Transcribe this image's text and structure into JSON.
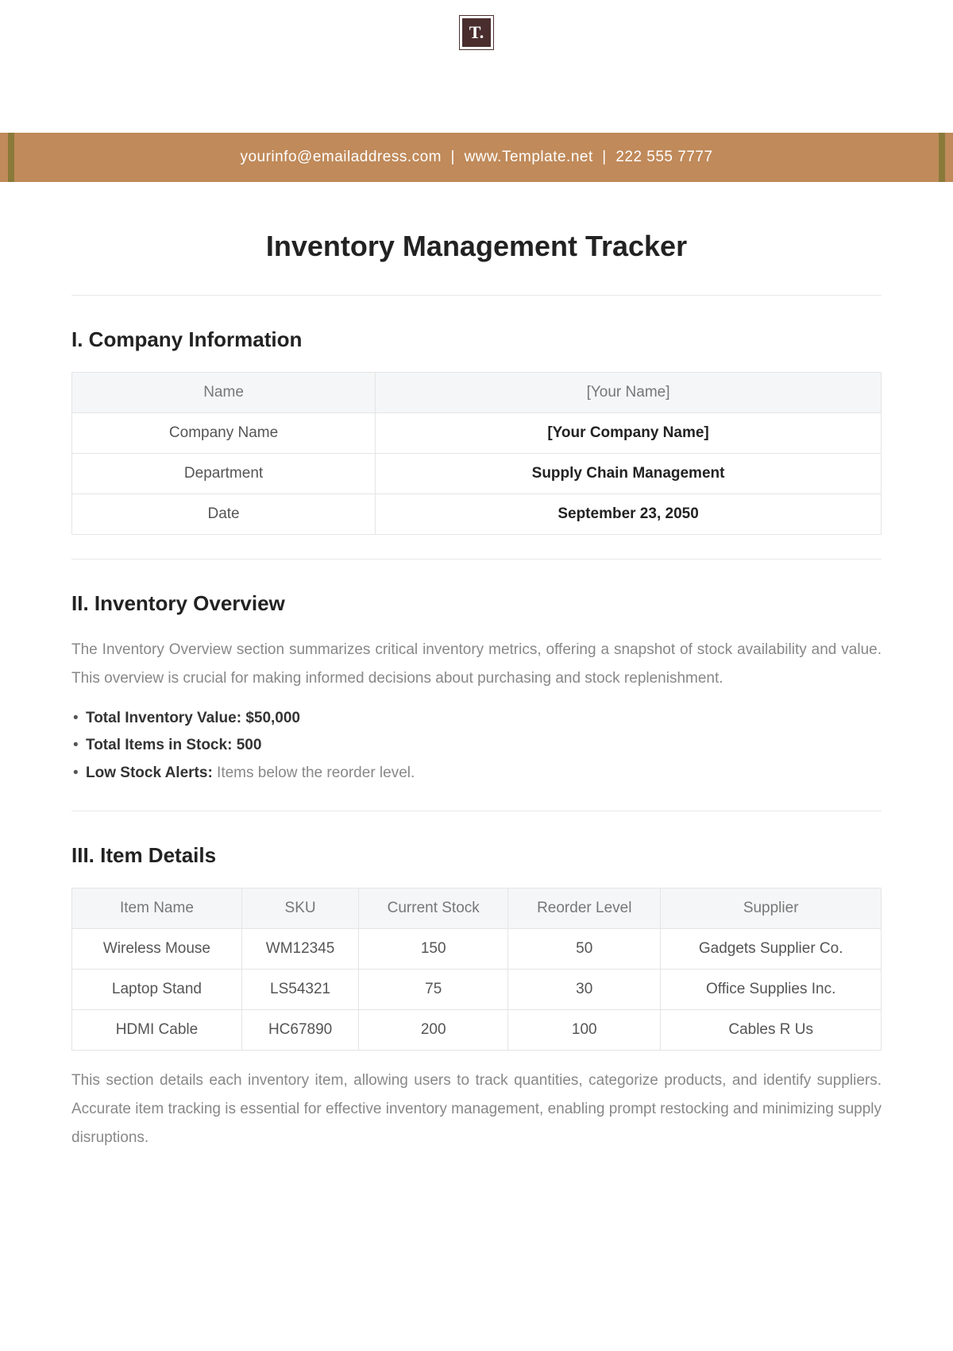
{
  "logo_text": "T.",
  "banner": {
    "email": "yourinfo@emailaddress.com",
    "website": "www.Template.net",
    "phone": "222 555 7777"
  },
  "title": "Inventory Management Tracker",
  "section1": {
    "heading": "I. Company Information",
    "rows": [
      {
        "label": "Name",
        "value": "[Your Name]"
      },
      {
        "label": "Company Name",
        "value": "[Your Company Name]"
      },
      {
        "label": "Department",
        "value": "Supply Chain Management"
      },
      {
        "label": "Date",
        "value": "September 23, 2050"
      }
    ]
  },
  "section2": {
    "heading": "II. Inventory Overview",
    "body": "The Inventory Overview section summarizes critical inventory metrics, offering a snapshot of stock availability and value. This overview is crucial for making informed decisions about purchasing and stock replenishment.",
    "bullets": [
      {
        "label": "Total Inventory Value:",
        "value": "$50,000"
      },
      {
        "label": "Total Items in Stock:",
        "value": "500"
      },
      {
        "label": "Low Stock Alerts:",
        "value": "Items below the reorder level."
      }
    ]
  },
  "section3": {
    "heading": "III. Item Details",
    "headers": [
      "Item Name",
      "SKU",
      "Current Stock",
      "Reorder Level",
      "Supplier"
    ],
    "rows": [
      [
        "Wireless Mouse",
        "WM12345",
        "150",
        "50",
        "Gadgets Supplier Co."
      ],
      [
        "Laptop Stand",
        "LS54321",
        "75",
        "30",
        "Office Supplies Inc."
      ],
      [
        "HDMI Cable",
        "HC67890",
        "200",
        "100",
        "Cables R Us"
      ]
    ],
    "body": "This section details each inventory item, allowing users to track quantities, categorize products, and identify suppliers. Accurate item tracking is essential for effective inventory management, enabling prompt restocking and minimizing supply disruptions."
  }
}
